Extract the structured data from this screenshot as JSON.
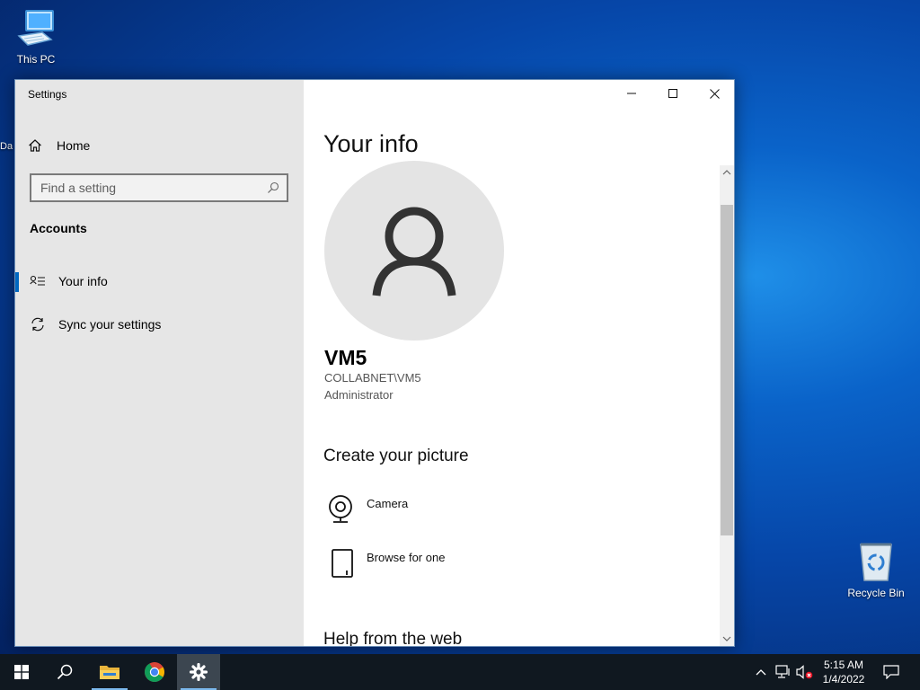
{
  "desktop": {
    "this_pc_label": "This PC",
    "recycle_bin_label": "Recycle Bin",
    "edge_fragment": "Da"
  },
  "window": {
    "title": "Settings",
    "accent_color": "#0067c0"
  },
  "sidebar": {
    "home_label": "Home",
    "search_placeholder": "Find a setting",
    "section_label": "Accounts",
    "items": [
      {
        "label": "Your info",
        "icon": "contact-card-icon",
        "selected": true
      },
      {
        "label": "Sync your settings",
        "icon": "sync-icon",
        "selected": false
      }
    ]
  },
  "content": {
    "page_title": "Your info",
    "user_name": "VM5",
    "user_domain": "COLLABNET\\VM5",
    "user_role": "Administrator",
    "create_section_title": "Create your picture",
    "options": [
      {
        "label": "Camera",
        "icon": "camera-icon"
      },
      {
        "label": "Browse for one",
        "icon": "browse-file-icon"
      }
    ],
    "help_section_title": "Help from the web"
  },
  "taskbar": {
    "apps": [
      "start-icon",
      "search-icon",
      "file-explorer-icon",
      "chrome-icon",
      "settings-gear-icon"
    ],
    "active_app": "settings-gear-icon",
    "time": "5:15 AM",
    "date": "1/4/2022"
  }
}
